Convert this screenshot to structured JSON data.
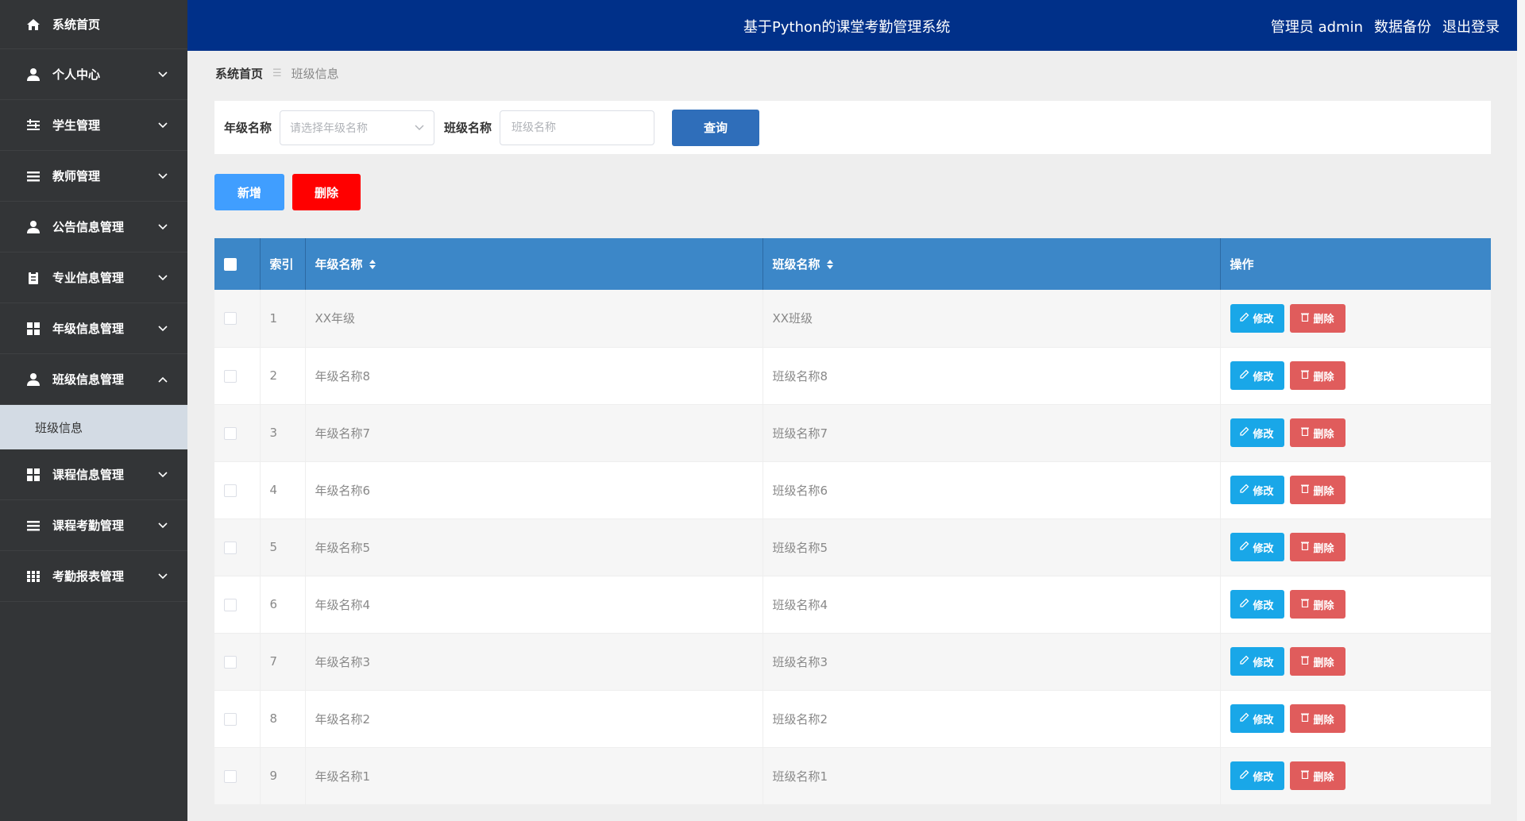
{
  "header": {
    "title": "基于Python的课堂考勤管理系统",
    "admin": "管理员 admin",
    "backup": "数据备份",
    "logout": "退出登录"
  },
  "sidebar": {
    "items": [
      {
        "label": "系统首页",
        "icon": "home-icon"
      },
      {
        "label": "个人中心",
        "icon": "user-icon"
      },
      {
        "label": "学生管理",
        "icon": "sliders-icon"
      },
      {
        "label": "教师管理",
        "icon": "list-icon"
      },
      {
        "label": "公告信息管理",
        "icon": "user-icon"
      },
      {
        "label": "专业信息管理",
        "icon": "clipboard-icon"
      },
      {
        "label": "年级信息管理",
        "icon": "grid-icon"
      },
      {
        "label": "班级信息管理",
        "icon": "user-icon"
      },
      {
        "label": "课程信息管理",
        "icon": "grid-icon"
      },
      {
        "label": "课程考勤管理",
        "icon": "list-icon"
      },
      {
        "label": "考勤报表管理",
        "icon": "table-icon"
      }
    ],
    "active_sub": "班级信息"
  },
  "breadcrumb": {
    "home": "系统首页",
    "current": "班级信息"
  },
  "search": {
    "grade_label": "年级名称",
    "grade_placeholder": "请选择年级名称",
    "class_label": "班级名称",
    "class_placeholder": "班级名称",
    "query": "查询"
  },
  "actions": {
    "add": "新增",
    "delete": "删除"
  },
  "table": {
    "columns": {
      "index": "索引",
      "grade": "年级名称",
      "class": "班级名称",
      "ops": "操作"
    },
    "edit_label": "修改",
    "delete_label": "删除",
    "rows": [
      {
        "index": "1",
        "grade": "XX年级",
        "class": "XX班级"
      },
      {
        "index": "2",
        "grade": "年级名称8",
        "class": "班级名称8"
      },
      {
        "index": "3",
        "grade": "年级名称7",
        "class": "班级名称7"
      },
      {
        "index": "4",
        "grade": "年级名称6",
        "class": "班级名称6"
      },
      {
        "index": "5",
        "grade": "年级名称5",
        "class": "班级名称5"
      },
      {
        "index": "6",
        "grade": "年级名称4",
        "class": "班级名称4"
      },
      {
        "index": "7",
        "grade": "年级名称3",
        "class": "班级名称3"
      },
      {
        "index": "8",
        "grade": "年级名称2",
        "class": "班级名称2"
      },
      {
        "index": "9",
        "grade": "年级名称1",
        "class": "班级名称1"
      }
    ]
  },
  "colors": {
    "header": "#003089",
    "sidebar": "#333537",
    "table_head": "#3c87c8",
    "edit": "#19a7e8",
    "delete": "#e05c5c"
  }
}
